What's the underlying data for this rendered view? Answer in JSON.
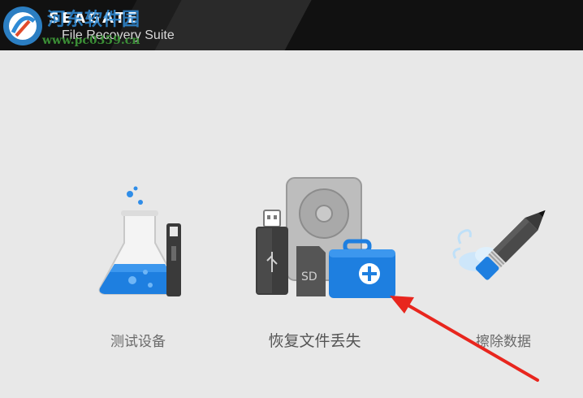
{
  "header": {
    "brand": "SEAGATE",
    "product": "File Recovery Suite"
  },
  "watermark": {
    "site_name": "河东软件园",
    "url": "www.pc0359.cn"
  },
  "options": [
    {
      "label": "测试设备",
      "icon": "flask-icon"
    },
    {
      "label": "恢复文件丢失",
      "icon": "recovery-devices-icon"
    },
    {
      "label": "擦除数据",
      "icon": "pencil-eraser-icon"
    }
  ],
  "annotation": {
    "arrow_color": "#e8261e",
    "points_to": "恢复文件丢失"
  },
  "colors": {
    "header_bg": "#111111",
    "body_bg": "#e8e8e8",
    "accent_blue": "#1e7fe0",
    "label_gray": "#6a6a6a"
  }
}
